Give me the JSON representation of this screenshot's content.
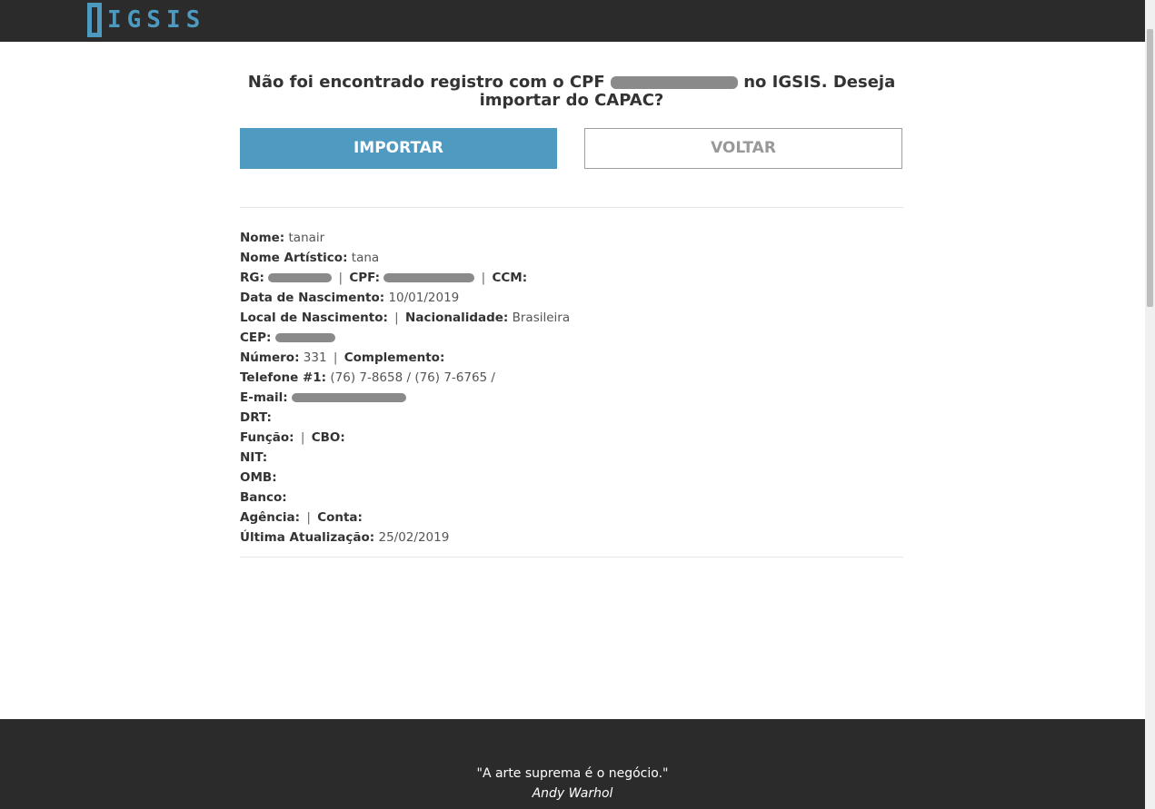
{
  "header": {
    "logo_text": "IGSIS"
  },
  "question": {
    "part1": "Não foi encontrado registro com o CPF",
    "part2": "no IGSIS. Deseja importar do CAPAC?"
  },
  "buttons": {
    "import_label": "IMPORTAR",
    "back_label": "VOLTAR"
  },
  "details": {
    "nome_label": "Nome:",
    "nome_value": "tanair",
    "nome_artistico_label": "Nome Artístico:",
    "nome_artistico_value": "tana",
    "rg_label": "RG:",
    "cpf_label": "CPF:",
    "ccm_label": "CCM:",
    "nascimento_label": "Data de Nascimento:",
    "nascimento_value": "10/01/2019",
    "local_nascimento_label": "Local de Nascimento:",
    "nacionalidade_label": "Nacionalidade:",
    "nacionalidade_value": "Brasileira",
    "cep_label": "CEP:",
    "numero_label": "Número:",
    "numero_value": "331",
    "complemento_label": "Complemento:",
    "telefone_label": "Telefone #1:",
    "telefone_value": "(76) 7-8658 / (76) 7-6765 /",
    "email_label": "E-mail:",
    "drt_label": "DRT:",
    "funcao_label": "Função:",
    "cbo_label": "CBO:",
    "nit_label": "NIT:",
    "omb_label": "OMB:",
    "banco_label": "Banco:",
    "agencia_label": "Agência:",
    "conta_label": "Conta:",
    "atualizacao_label": "Última Atualização:",
    "atualizacao_value": "25/02/2019"
  },
  "footer": {
    "quote": "\"A arte suprema é o negócio.\"",
    "author": "Andy Warhol"
  }
}
